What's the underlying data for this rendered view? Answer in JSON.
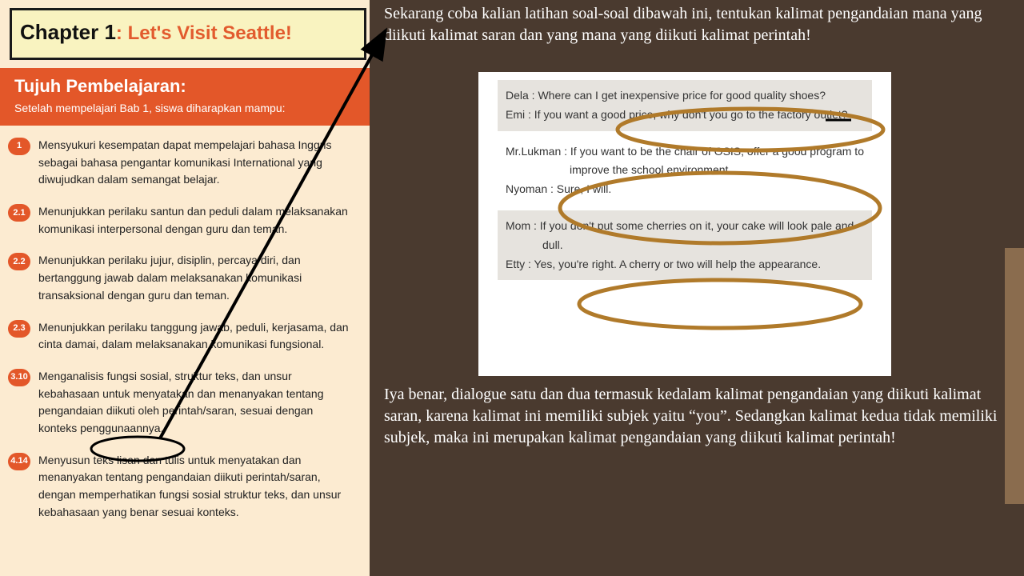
{
  "chapter": {
    "label": "Chapter 1",
    "subtitle": ": Let's Visit Seattle!"
  },
  "objectives": {
    "heading": "Tujuh Pembelajaran:",
    "subheading": "Setelah mempelajari Bab 1, siswa diharapkan mampu:",
    "items": [
      {
        "n": "1",
        "t": "Mensyukuri kesempatan dapat mempelajari bahasa Inggris sebagai bahasa pengantar komunikasi International yang diwujudkan dalam semangat belajar."
      },
      {
        "n": "2.1",
        "t": "Menunjukkan perilaku santun dan peduli dalam melaksanakan komunikasi interpersonal dengan guru dan teman."
      },
      {
        "n": "2.2",
        "t": "Menunjukkan perilaku jujur, disiplin, percaya diri, dan bertanggung jawab dalam melaksanakan komunikasi transaksional dengan guru dan teman."
      },
      {
        "n": "2.3",
        "t": "Menunjukkan perilaku tanggung jawab, peduli, kerjasama, dan cinta damai, dalam melaksanakan komunikasi fungsional."
      },
      {
        "n": "3.10",
        "t": "Menganalisis fungsi sosial, struktur teks, dan unsur kebahasaan untuk menyatakan dan menanyakan tentang pengandaian diikuti oleh perintah/saran, sesuai dengan konteks penggunaannya."
      },
      {
        "n": "4.14",
        "t": "Menyusun teks lisan dan tulis untuk menyatakan dan menanyakan tentang pengandaian diikuti perintah/saran, dengan memperhatikan fungsi sosial struktur teks, dan unsur kebahasaan yang benar sesuai konteks."
      }
    ]
  },
  "intro_text": "Sekarang coba kalian latihan soal-soal dibawah ini, tentukan kalimat pengandaian mana yang diikuti kalimat saran dan yang mana yang diikuti kalimat perintah!",
  "dialogues": {
    "d1a": "Dela : Where can I get inexpensive price for good quality shoes?",
    "d1b": "Emi : If you want a good price, why don't you go to the factory outlet?",
    "d2a": "Mr.Lukman : If you want to be the chair of OSIS, offer a good program to improve the school environment.",
    "d2b": "Nyoman : Sure, I will.",
    "d3a": "Mom : If you don't put some cherries on it, your cake will look pale and dull.",
    "d3b": "Etty : Yes, you're right. A cherry or two will help the appearance."
  },
  "conclusion_text": "Iya benar, dialogue satu dan dua termasuk kedalam kalimat pengandaian yang diikuti kalimat saran, karena kalimat ini memiliki subjek yaitu “you”. Sedangkan kalimat kedua tidak memiliki subjek, maka ini merupakan kalimat pengandaian yang diikuti kalimat perintah!",
  "colors": {
    "bg": "#4a3a2f",
    "page": "#fcebd1",
    "chapter_bg": "#f9f3c0",
    "accent": "#e35729",
    "circle": "#b07a2a"
  }
}
